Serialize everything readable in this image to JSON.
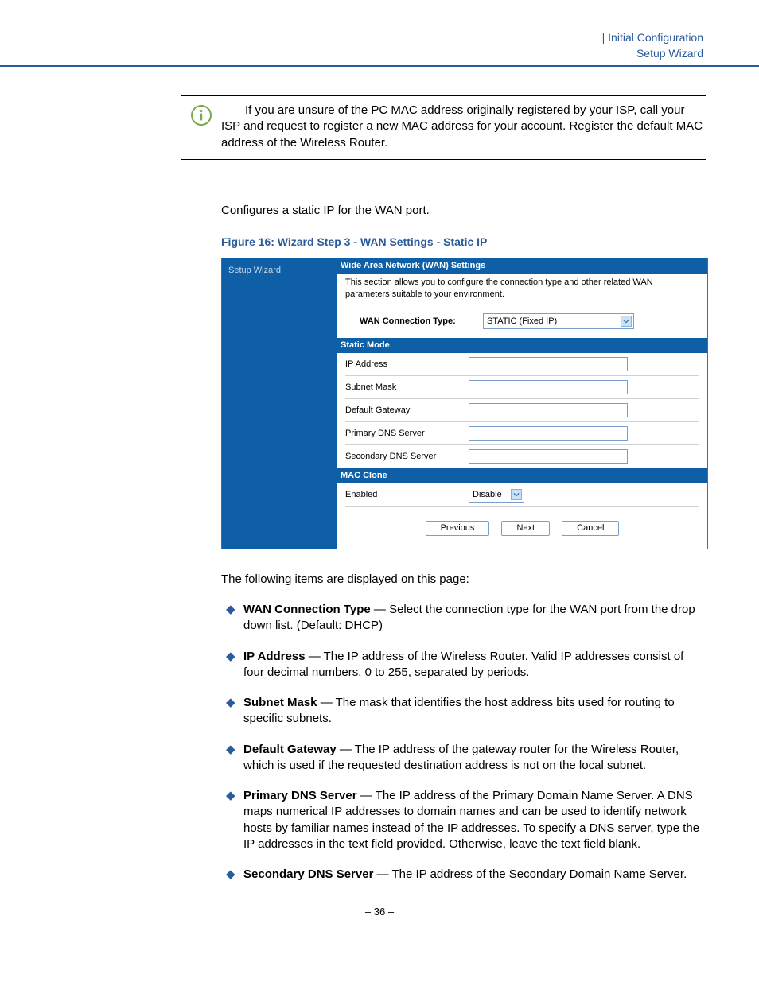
{
  "header": {
    "line1": "|   Initial Configuration",
    "line2": "Setup Wizard"
  },
  "info_note": "If you are unsure of the PC MAC address originally registered by your ISP, call your ISP and request to register a new MAC address for your account. Register the default MAC address of the Wireless Router.",
  "intro_para": "Configures a static IP for the WAN port.",
  "figure_caption": "Figure 16:  Wizard Step 3 - WAN Settings - Static IP",
  "screenshot": {
    "sidebar_item": "Setup Wizard",
    "panel_title": "Wide Area Network (WAN) Settings",
    "panel_desc": "This section allows you to configure the connection type and other related WAN parameters suitable to your environment.",
    "conn_label": "WAN Connection Type:",
    "conn_value": "STATIC (Fixed IP)",
    "static_mode_header": "Static Mode",
    "fields": [
      {
        "label": "IP Address",
        "value": ""
      },
      {
        "label": "Subnet Mask",
        "value": ""
      },
      {
        "label": "Default Gateway",
        "value": ""
      },
      {
        "label": "Primary DNS Server",
        "value": ""
      },
      {
        "label": "Secondary DNS Server",
        "value": ""
      }
    ],
    "mac_clone_header": "MAC Clone",
    "mac_enabled_label": "Enabled",
    "mac_enabled_value": "Disable",
    "btn_prev": "Previous",
    "btn_next": "Next",
    "btn_cancel": "Cancel"
  },
  "body_intro": "The following items are displayed on this page:",
  "bullets": [
    {
      "term": "WAN Connection Type",
      "desc": " — Select the connection type for the WAN port from the drop down list. (Default: DHCP)"
    },
    {
      "term": "IP Address",
      "desc": " — The IP address of the Wireless Router. Valid IP addresses consist of four decimal numbers, 0 to 255, separated by periods."
    },
    {
      "term": "Subnet Mask",
      "desc": " — The mask that identifies the host address bits used for routing to specific subnets."
    },
    {
      "term": "Default Gateway",
      "desc": " — The IP address of the gateway router for the Wireless Router, which is used if the requested destination address is not on the local subnet."
    },
    {
      "term": "Primary DNS Server",
      "desc": " — The IP address of the Primary Domain Name Server. A DNS maps numerical IP addresses to domain names and can be used to identify network hosts by familiar names instead of the IP addresses. To specify a DNS server, type the IP addresses in the text field provided. Otherwise, leave the text field blank."
    },
    {
      "term": "Secondary DNS Server",
      "desc": " — The IP address of the Secondary Domain Name Server."
    }
  ],
  "page_number": "–  36  –"
}
